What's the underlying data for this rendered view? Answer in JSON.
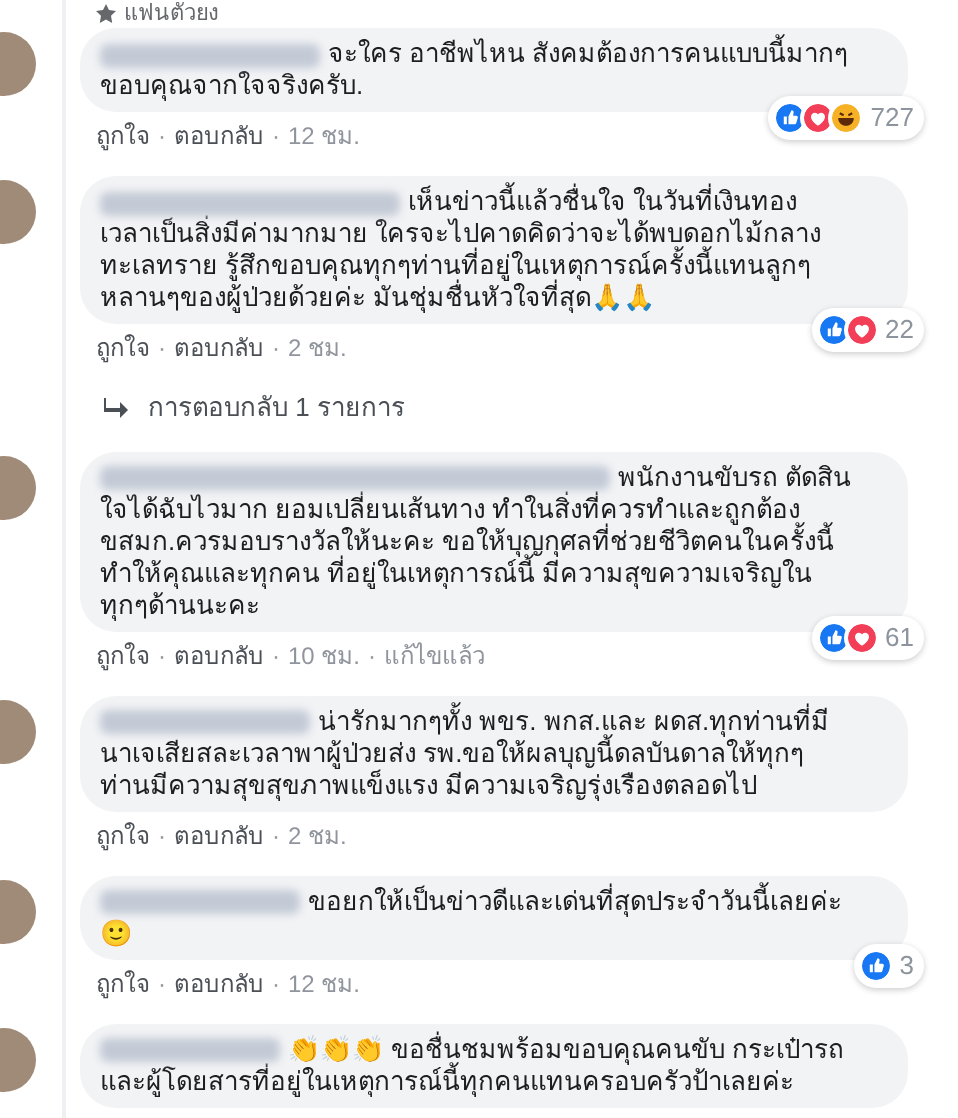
{
  "top_badge": {
    "label": "แฟนตัวยง"
  },
  "separator": "·",
  "comments": [
    {
      "lines": [
        "จะใคร อาชีพไหน สังคมต้องการคนแบบนี้มากๆ",
        "ขอบคุณจากใจจริงครับ."
      ],
      "reactions": [
        {
          "kind": "like"
        },
        {
          "kind": "love"
        },
        {
          "kind": "haha"
        }
      ],
      "reaction_count": "727",
      "actions": [
        "ถูกใจ",
        "ตอบกลับ",
        "12 ชม."
      ]
    },
    {
      "lines": [
        "เห็นข่าวนี้แล้วชื่นใจ ในวันที่เงินทอง",
        "เวลาเป็นสิ่งมีค่ามากมาย ใครจะไปคาดคิดว่าจะได้พบดอกไม้กลาง",
        "ทะเลทราย รู้สึกขอบคุณทุกๆท่านที่อยู่ในเหตุการณ์ครั้งนี้แทนลูกๆ",
        "หลานๆของผู้ป่วยด้วยค่ะ มันชุ่มชื่นหัวใจที่สุด🙏🙏"
      ],
      "reactions": [
        {
          "kind": "like"
        },
        {
          "kind": "love"
        }
      ],
      "reaction_count": "22",
      "actions": [
        "ถูกใจ",
        "ตอบกลับ",
        "2 ชม."
      ],
      "replies_link": "การตอบกลับ 1 รายการ"
    },
    {
      "lines": [
        "พนักงานขับรถ ตัดสิน",
        "ใจได้ฉับไวมาก ยอมเปลี่ยนเส้นทาง ทำในสิ่งที่ควรทำและถูกต้อง",
        "ขสมก.ควรมอบรางวัลให้นะคะ ขอให้บุญกุศลที่ช่วยชีวิตคนในครั้งนี้",
        "ทำให้คุณและทุกคน ที่อยู่ในเหตุการณ์นี้ มีความสุขความเจริญใน",
        "ทุกๆด้านนะคะ"
      ],
      "reactions": [
        {
          "kind": "like"
        },
        {
          "kind": "love"
        }
      ],
      "reaction_count": "61",
      "actions": [
        "ถูกใจ",
        "ตอบกลับ",
        "10 ชม.",
        "แก้ไขแล้ว"
      ]
    },
    {
      "lines": [
        "น่ารักมากๆทั้ง พขร. พกส.และ ผดส.ทุกท่านที่มี",
        "นาเจเสียสละเวลาพาผู้ป่วยส่ง รพ.ขอให้ผลบุญนี้ดลบันดาลให้ทุกๆ",
        "ท่านมีความสุขสุขภาพแข็งแรง มีความเจริญรุ่งเรืองตลอดไป"
      ],
      "actions": [
        "ถูกใจ",
        "ตอบกลับ",
        "2 ชม."
      ]
    },
    {
      "lines": [
        "ขอยกให้เป็นข่าวดีและเด่นที่สุดประจำวันนี้เลยค่ะ",
        "🙂"
      ],
      "reactions": [
        {
          "kind": "like"
        }
      ],
      "reaction_count": "3",
      "actions": [
        "ถูกใจ",
        "ตอบกลับ",
        "12 ชม."
      ]
    },
    {
      "lines": [
        "👏👏👏 ขอชื่นชมพร้อมขอบคุณคนขับ กระเป๋ารถ",
        "และผู้โดยสารที่อยู่ในเหตุการณ์นี้ทุกคนแทนครอบครัวป้าเลยค่ะ"
      ]
    }
  ]
}
